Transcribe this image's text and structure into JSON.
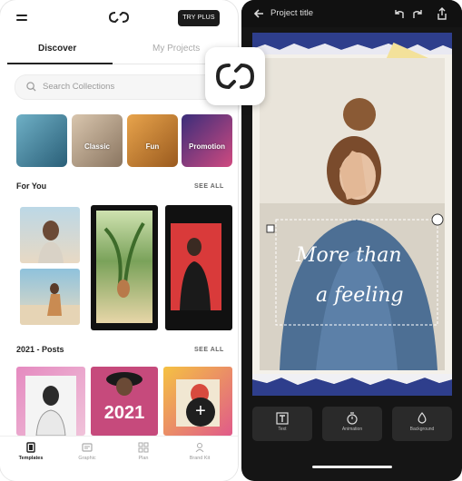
{
  "left": {
    "header": {
      "try_plus": "TRY PLUS"
    },
    "tabs": [
      {
        "label": "Discover",
        "active": true
      },
      {
        "label": "My Projects",
        "active": false
      }
    ],
    "search": {
      "placeholder": "Search Collections"
    },
    "collections": [
      {
        "label": "",
        "colors": [
          "#4f8fa8",
          "#2d6b85"
        ]
      },
      {
        "label": "Classic",
        "colors": [
          "#c9b39a",
          "#8f7a64"
        ]
      },
      {
        "label": "Fun",
        "colors": [
          "#d8923a",
          "#9a5a1e"
        ]
      },
      {
        "label": "Promotion",
        "colors": [
          "#7a3b8c",
          "#c34b7f"
        ]
      }
    ],
    "sections": [
      {
        "title": "For You",
        "see_all": "SEE ALL"
      },
      {
        "title": "2021 - Posts",
        "see_all": "SEE ALL"
      }
    ],
    "poster_text": "2021",
    "fab_label": "+",
    "bottom_nav": [
      {
        "label": "Templates",
        "icon": "templates-icon",
        "active": true
      },
      {
        "label": "Graphic",
        "icon": "graphic-icon",
        "active": false
      },
      {
        "label": "Plan",
        "icon": "plan-icon",
        "active": false
      },
      {
        "label": "Brand Kit",
        "icon": "brand-kit-icon",
        "active": false
      }
    ]
  },
  "right": {
    "project_title": "Project title",
    "canvas_script": "More than a feeling",
    "tools": [
      {
        "label": "Text",
        "icon": "text-icon"
      },
      {
        "label": "Animation",
        "icon": "timer-icon"
      },
      {
        "label": "Background",
        "icon": "drop-icon"
      }
    ]
  },
  "colors": {
    "dark_panel": "#151515",
    "accent_dark": "#1b1b1b",
    "canvas_border_blue": "#2e3e8c"
  }
}
